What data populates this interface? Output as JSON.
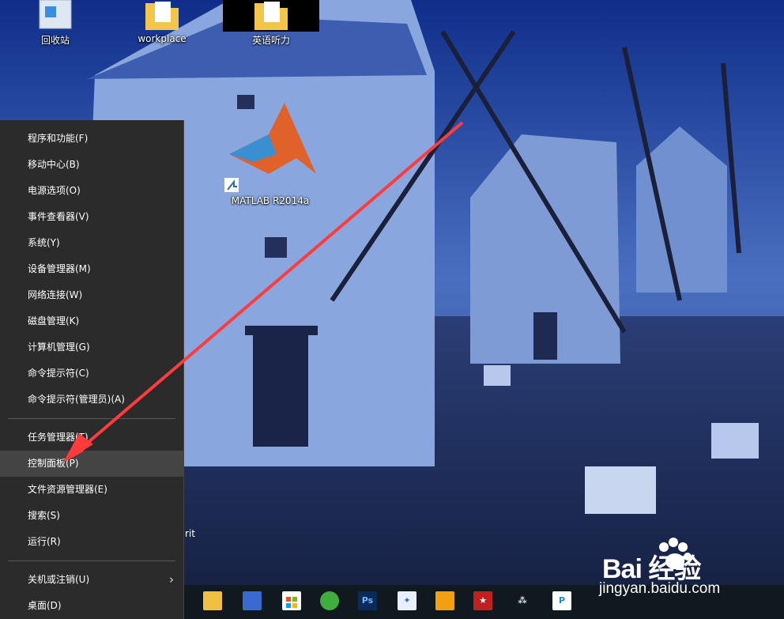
{
  "desktop": {
    "icons": [
      {
        "id": "recycle",
        "label": "回收站"
      },
      {
        "id": "workplace",
        "label": "workplace"
      },
      {
        "id": "listening",
        "label": "英语听力"
      },
      {
        "id": "matlab",
        "label": "MATLAB R2014a"
      }
    ],
    "partial_label": "rit"
  },
  "winx_menu": {
    "items": [
      {
        "label": "程序和功能(F)"
      },
      {
        "label": "移动中心(B)"
      },
      {
        "label": "电源选项(O)"
      },
      {
        "label": "事件查看器(V)"
      },
      {
        "label": "系统(Y)"
      },
      {
        "label": "设备管理器(M)"
      },
      {
        "label": "网络连接(W)"
      },
      {
        "label": "磁盘管理(K)"
      },
      {
        "label": "计算机管理(G)"
      },
      {
        "label": "命令提示符(C)"
      },
      {
        "label": "命令提示符(管理员)(A)"
      },
      {
        "label": "任务管理器(T)"
      },
      {
        "label": "控制面板(P)",
        "highlighted": true
      },
      {
        "label": "文件资源管理器(E)"
      },
      {
        "label": "搜索(S)"
      },
      {
        "label": "运行(R)"
      },
      {
        "label": "关机或注销(U)",
        "has_submenu": true
      },
      {
        "label": "桌面(D)"
      }
    ],
    "colors": {
      "bg": "#2b2b2b",
      "highlight": "#444444",
      "text": "#ffffff"
    }
  },
  "taskbar": {
    "icons": [
      "file-explorer-icon",
      "app-icon",
      "store-icon",
      "browser-icon",
      "photoshop-icon",
      "bird-app-icon",
      "mail-icon",
      "bookmark-app-icon",
      "network-icon",
      "p-app-icon"
    ]
  },
  "watermark": {
    "brand": "Bai 经验",
    "url": "jingyan.baidu.com"
  },
  "annotation": {
    "color": "#ff3b3b"
  }
}
